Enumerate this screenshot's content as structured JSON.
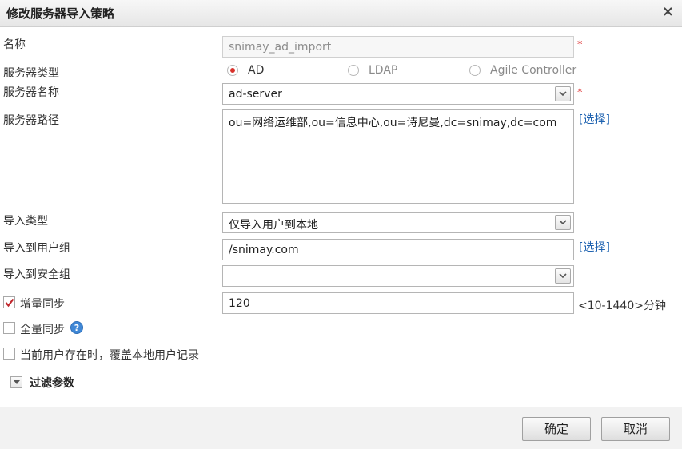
{
  "dialog": {
    "title": "修改服务器导入策略",
    "close_icon": "×"
  },
  "form": {
    "name": {
      "label": "名称",
      "value": "snimay_ad_import",
      "required": "*"
    },
    "server_type": {
      "label": "服务器类型",
      "options": [
        "AD",
        "LDAP",
        "Agile Controller"
      ],
      "selected": "AD"
    },
    "server_name": {
      "label": "服务器名称",
      "value": "ad-server",
      "required": "*"
    },
    "server_path": {
      "label": "服务器路径",
      "value": "ou=网络运维部,ou=信息中心,ou=诗尼曼,dc=snimay,dc=com",
      "select_link": "[选择]"
    },
    "import_type": {
      "label": "导入类型",
      "value": "仅导入用户到本地"
    },
    "user_group": {
      "label": "导入到用户组",
      "value": "/snimay.com",
      "select_link": "[选择]"
    },
    "security_group": {
      "label": "导入到安全组",
      "value": ""
    },
    "incremental_sync": {
      "label": "增量同步",
      "checked": true,
      "value": "120",
      "hint": "<10-1440>分钟"
    },
    "full_sync": {
      "label": "全量同步",
      "checked": false,
      "help_icon": "?"
    },
    "overwrite": {
      "label": "当前用户存在时，覆盖本地用户记录",
      "checked": false
    },
    "filter": {
      "label": "过滤参数"
    }
  },
  "footer": {
    "ok_label": "确定",
    "cancel_label": "取消"
  },
  "colors": {
    "required": "#e03a3a",
    "link": "#1e62b0",
    "radio_dot": "#d8322b",
    "check": "#c0272d",
    "help": "#3f87d6"
  }
}
